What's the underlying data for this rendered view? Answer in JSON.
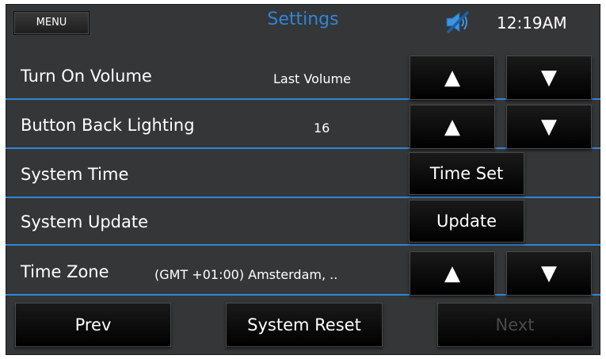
{
  "header": {
    "menu_label": "MENU",
    "title": "Settings",
    "time": "12:19AM",
    "mute_icon": "speaker-muted-icon"
  },
  "rows": [
    {
      "label": "Turn On Volume",
      "value": "Last Volume",
      "controls": "arrows"
    },
    {
      "label": "Button Back Lighting",
      "value": "16",
      "controls": "arrows"
    },
    {
      "label": "System Time",
      "button": "Time Set"
    },
    {
      "label": "System Update",
      "button": "Update"
    },
    {
      "label": "Time Zone",
      "value": "(GMT +01:00) Amsterdam, ..",
      "controls": "arrows"
    }
  ],
  "arrows": {
    "up": "▲",
    "down": "▼"
  },
  "footer": {
    "prev_label": "Prev",
    "reset_label": "System Reset",
    "next_label": "Next",
    "next_enabled": false
  },
  "colors": {
    "background": "#353637",
    "accent": "#2f86d8",
    "text": "#ffffff",
    "disabled_text": "#4a4a4a",
    "button": "#000000"
  }
}
